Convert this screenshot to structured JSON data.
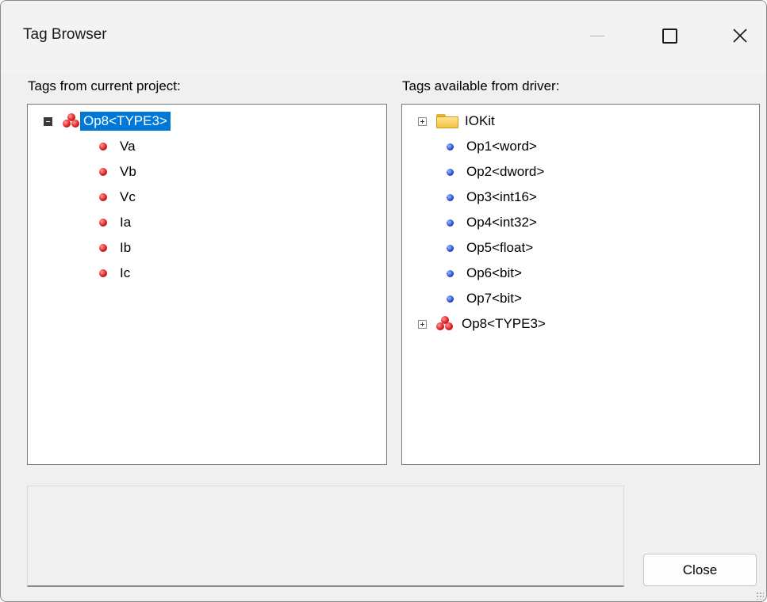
{
  "window": {
    "title": "Tag Browser"
  },
  "left_panel": {
    "label": "Tags from current project:",
    "root": {
      "label": "Op8<TYPE3>",
      "icon": "red-ball-cluster-icon",
      "expanded": true,
      "selected": true
    },
    "children": [
      {
        "label": "Va",
        "icon": "red-dot-icon"
      },
      {
        "label": "Vb",
        "icon": "red-dot-icon"
      },
      {
        "label": "Vc",
        "icon": "red-dot-icon"
      },
      {
        "label": "Ia",
        "icon": "red-dot-icon"
      },
      {
        "label": "Ib",
        "icon": "red-dot-icon"
      },
      {
        "label": "Ic",
        "icon": "red-dot-icon"
      }
    ]
  },
  "right_panel": {
    "label": "Tags available from driver:",
    "items": [
      {
        "label": "IOKit",
        "icon": "folder-icon",
        "expandable": true
      },
      {
        "label": "Op1<word>",
        "icon": "blue-dot-icon"
      },
      {
        "label": "Op2<dword>",
        "icon": "blue-dot-icon"
      },
      {
        "label": "Op3<int16>",
        "icon": "blue-dot-icon"
      },
      {
        "label": "Op4<int32>",
        "icon": "blue-dot-icon"
      },
      {
        "label": "Op5<float>",
        "icon": "blue-dot-icon"
      },
      {
        "label": "Op6<bit>",
        "icon": "blue-dot-icon"
      },
      {
        "label": "Op7<bit>",
        "icon": "blue-dot-icon"
      },
      {
        "label": "Op8<TYPE3>",
        "icon": "red-ball-cluster-icon",
        "expandable": true
      }
    ]
  },
  "footer": {
    "close_label": "Close"
  },
  "colors": {
    "selection": "#0078d7",
    "dialog_bg": "#f0f0f0"
  }
}
